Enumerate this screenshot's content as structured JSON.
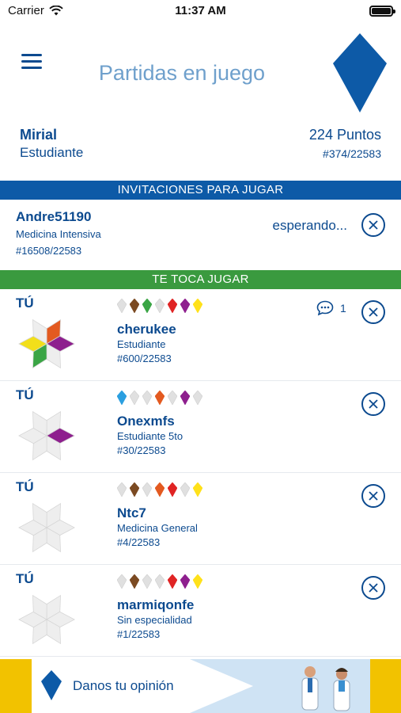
{
  "status_bar": {
    "carrier": "Carrier",
    "time": "11:37 AM"
  },
  "header": {
    "title": "Partidas en juego"
  },
  "user": {
    "name": "Mirial",
    "role": "Estudiante",
    "points": "224 Puntos",
    "rank": "#374/22583"
  },
  "invitations": {
    "section_title": "INVITACIONES PARA JUGAR",
    "items": [
      {
        "name": "Andre51190",
        "specialty": "Medicina Intensiva",
        "rank": "#16508/22583",
        "status": "esperando..."
      }
    ]
  },
  "turn": {
    "section_title": "TE TOCA JUGAR",
    "games": [
      {
        "label": "TÚ",
        "opponent": "cherukee",
        "specialty": "Estudiante",
        "rank": "#600/22583",
        "chat_count": "1",
        "gems": [
          "#e0e0e0",
          "#7b4a22",
          "#3aa545",
          "#e0e0e0",
          "#e02424",
          "#8e1f8e",
          "#ffe11a"
        ],
        "star": [
          "#e35a20",
          "#8e1f8e",
          "#eeeeee",
          "#3aa545",
          "#f2df1a",
          "#eeeeee"
        ]
      },
      {
        "label": "TÚ",
        "opponent": "Onexmfs",
        "specialty": "Estudiante 5to",
        "rank": "#30/22583",
        "chat_count": "",
        "gems": [
          "#2b9fe0",
          "#e0e0e0",
          "#e0e0e0",
          "#e35a20",
          "#e0e0e0",
          "#8e1f8e",
          "#e0e0e0"
        ],
        "star": [
          "#eeeeee",
          "#8e1f8e",
          "#eeeeee",
          "#eeeeee",
          "#eeeeee",
          "#eeeeee"
        ]
      },
      {
        "label": "TÚ",
        "opponent": "Ntc7",
        "specialty": "Medicina General",
        "rank": "#4/22583",
        "chat_count": "",
        "gems": [
          "#e0e0e0",
          "#7b4a22",
          "#e0e0e0",
          "#e35a20",
          "#e02424",
          "#e0e0e0",
          "#ffe11a"
        ],
        "star": [
          "#eeeeee",
          "#eeeeee",
          "#eeeeee",
          "#eeeeee",
          "#eeeeee",
          "#eeeeee"
        ]
      },
      {
        "label": "TÚ",
        "opponent": "marmiqonfe",
        "specialty": "Sin especialidad",
        "rank": "#1/22583",
        "chat_count": "",
        "gems": [
          "#e0e0e0",
          "#7b4a22",
          "#e0e0e0",
          "#e0e0e0",
          "#e02424",
          "#8e1f8e",
          "#ffe11a"
        ],
        "star": [
          "#eeeeee",
          "#eeeeee",
          "#eeeeee",
          "#eeeeee",
          "#eeeeee",
          "#eeeeee"
        ]
      }
    ]
  },
  "banner": {
    "label": "Danos tu opinión"
  },
  "colors": {
    "primary": "#0c4a8f",
    "invite_bar": "#0d5aa7",
    "turn_bar": "#3a9a3f",
    "banner_yellow": "#f2c200"
  },
  "icons": {
    "menu": "hamburger-icon",
    "logo": "kite-logo-icon",
    "close": "close-circle-icon",
    "chat": "chat-bubble-icon"
  }
}
